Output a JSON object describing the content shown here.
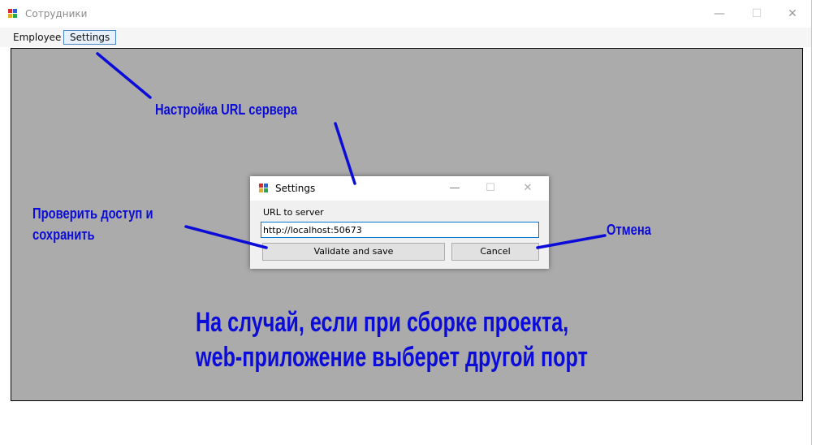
{
  "window": {
    "title": "Сотрудники",
    "controls": {
      "minimize": "—",
      "maximize": "☐",
      "close": "✕"
    }
  },
  "menu": {
    "items": [
      {
        "label": "Employee"
      },
      {
        "label": "Settings"
      }
    ]
  },
  "dialog": {
    "title": "Settings",
    "controls": {
      "minimize": "—",
      "maximize": "☐",
      "close": "✕"
    },
    "url_label": "URL to server",
    "url_value": "http://localhost:50673",
    "validate_label": "Validate and save",
    "cancel_label": "Cancel"
  },
  "annotations": {
    "settings_note": "Настройка URL сервера",
    "validate_note_line1": "Проверить доступ и",
    "validate_note_line2": "сохранить",
    "cancel_note": "Отмена",
    "footer_line1": "На случай, если при сборке проекта,",
    "footer_line2": "web-приложение выберет другой порт"
  },
  "colors": {
    "annotation": "#0c0cd8",
    "client_background": "#ababab",
    "input_focus_border": "#0078d7"
  }
}
